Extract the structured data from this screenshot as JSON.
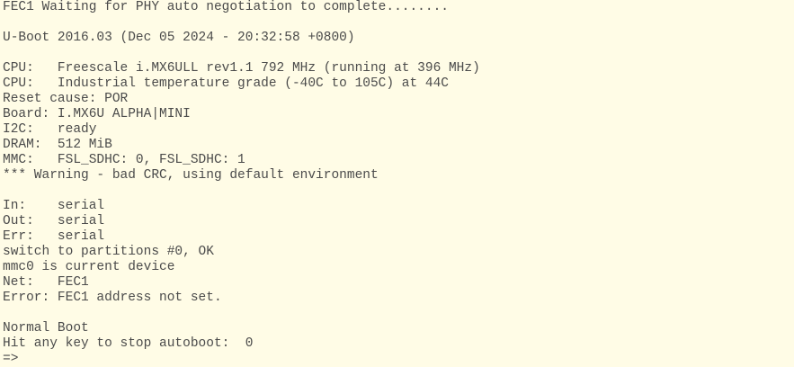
{
  "terminal": {
    "background": "#fffce6",
    "foreground": "#4b4b4b",
    "lines": [
      "FEC1 Waiting for PHY auto negotiation to complete........",
      "",
      "U-Boot 2016.03 (Dec 05 2024 - 20:32:58 +0800)",
      "",
      "CPU:   Freescale i.MX6ULL rev1.1 792 MHz (running at 396 MHz)",
      "CPU:   Industrial temperature grade (-40C to 105C) at 44C",
      "Reset cause: POR",
      "Board: I.MX6U ALPHA|MINI",
      "I2C:   ready",
      "DRAM:  512 MiB",
      "MMC:   FSL_SDHC: 0, FSL_SDHC: 1",
      "*** Warning - bad CRC, using default environment",
      "",
      "In:    serial",
      "Out:   serial",
      "Err:   serial",
      "switch to partitions #0, OK",
      "mmc0 is current device",
      "Net:   FEC1",
      "Error: FEC1 address not set.",
      "",
      "Normal Boot",
      "Hit any key to stop autoboot:  0"
    ],
    "prompt": "=>"
  }
}
